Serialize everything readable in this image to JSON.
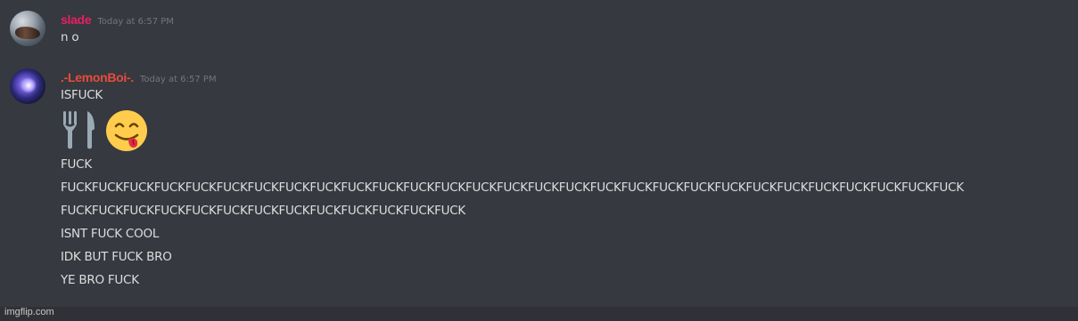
{
  "messages": [
    {
      "author": "slade",
      "author_color": "#e91e63",
      "timestamp": "Today at 6:57 PM",
      "lines": [
        "n o"
      ]
    },
    {
      "author": ".-LemonBoi-.",
      "author_color": "#e74c3c",
      "timestamp": "Today at 6:57 PM",
      "lines": [
        "ISFUCK",
        "FUCK",
        "FUCKFUCKFUCKFUCKFUCKFUCKFUCKFUCKFUCKFUCKFUCKFUCKFUCKFUCKFUCKFUCKFUCKFUCKFUCKFUCKFUCKFUCKFUCKFUCKFUCKFUCKFUCKFUCKFUCK",
        "FUCKFUCKFUCKFUCKFUCKFUCKFUCKFUCKFUCKFUCKFUCKFUCKFUCK",
        "ISNT FUCK COOL",
        "IDK BUT FUCK BRO",
        "YE BRO FUCK"
      ],
      "emojis": [
        "fork-and-knife-icon",
        "face-savoring-food-icon"
      ]
    }
  ],
  "watermark": "imgflip.com",
  "colors": {
    "background": "#36393f",
    "text": "#dcddde",
    "timestamp": "#72767d"
  }
}
